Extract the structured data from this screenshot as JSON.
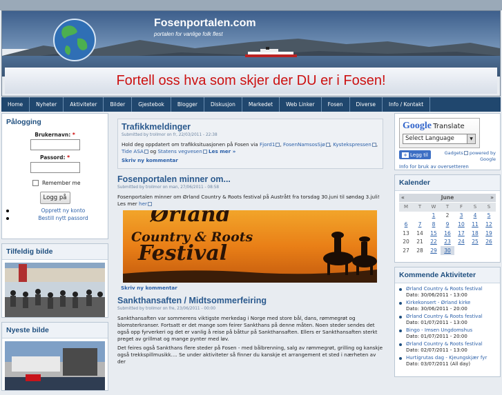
{
  "site": {
    "title": "Fosenportalen.com",
    "slogan": "portalen for vanlige folk flest",
    "banner": "Fortell oss hva som skjer der DU er i Fosen!"
  },
  "nav": [
    "Home",
    "Nyheter",
    "Aktiviteter",
    "Bilder",
    "Gjestebok",
    "Blogger",
    "Diskusjon",
    "Markedet",
    "Web Linker",
    "Fosen",
    "Diverse",
    "Info / Kontakt"
  ],
  "login": {
    "title": "Pålogging",
    "username_label": "Brukernavn:",
    "password_label": "Passord:",
    "required_mark": "*",
    "remember": "Remember me",
    "button": "Logg på",
    "links": [
      "Opprett ny konto",
      "Bestill nytt passord"
    ]
  },
  "random_image": {
    "title": "Tilfeldig bilde"
  },
  "newest_image": {
    "title": "Nyeste bilde"
  },
  "articles": [
    {
      "title": "Trafikkmeldinger",
      "submitted": "Submitted by trollmor on fr, 22/03/2011 - 22:38",
      "body_start": "Hold deg oppdatert om trafikksituasjonen på Fosen via ",
      "links": [
        "Fjord1",
        "FosenNamsosSjø",
        "Kystekspressen",
        "Tide ASA",
        "Statens vegvesen"
      ],
      "read_more": "Les mer »",
      "comment": "Skriv ny kommentar"
    },
    {
      "title": "Fosenportalen minner om...",
      "submitted": "Submitted by trollmor on man, 27/06/2011 - 08:58",
      "body": "Fosenportalen minner om Ørland Country & Roots festival på Austrått fra torsdag 30.juni til søndag 3.juli! Les mer",
      "here": "her",
      "image_text_1": "Ørland",
      "image_text_2": "Country & Roots",
      "image_text_3": "Festival",
      "comment": "Skriv ny kommentar"
    },
    {
      "title": "Sankthansaften / Midtsommerfeiring",
      "submitted": "Submitted by trollmor on fre, 23/06/2011 - 00:00",
      "body1": "Sankthansaften var sommerens viktigste merkedag i Norge med store bål, dans, rømmegrøt og blomsterkranser. Fortsatt er det mange som feirer Sankthans på denne måten. Noen steder sendes det også opp fyrverkeri og det er vanlig å reise på båttur på Sankthansaften. Ellers er Sankthansaften sterkt preget av grillmat og mange pynter med løv.",
      "body2": "Det feires også Sankthans flere steder på Fosen - med bålbrenning, salg av rømmegrøt, grilling og kanskje også trekkspillmusikk.... Se under aktiviteter så finner du kanskje et arrangement et sted i nærheten av der"
    }
  ],
  "translate": {
    "google": "Google",
    "translate": "Translate",
    "select": "Select Language",
    "gadgets": "Gadgets",
    "powered": "powered by",
    "google2": "Google",
    "info": "Info for bruk av oversetteren",
    "add_button": "Legg til"
  },
  "calendar": {
    "title": "Kalender",
    "prev": "«",
    "month": "June",
    "next": "»",
    "days": [
      "M",
      "T",
      "W",
      "T",
      "F",
      "S",
      "S"
    ],
    "weeks": [
      [
        "",
        "",
        "1",
        "2",
        "3",
        "4",
        "5"
      ],
      [
        "6",
        "7",
        "8",
        "9",
        "10",
        "11",
        "12"
      ],
      [
        "13",
        "14",
        "15",
        "16",
        "17",
        "18",
        "19"
      ],
      [
        "20",
        "21",
        "22",
        "23",
        "24",
        "25",
        "26"
      ],
      [
        "27",
        "28",
        "29",
        "30",
        "",
        "",
        ""
      ]
    ],
    "linked": [
      "1",
      "3",
      "4",
      "5",
      "6",
      "7",
      "8",
      "9",
      "10",
      "11",
      "12",
      "15",
      "16",
      "17",
      "18",
      "19",
      "22",
      "23",
      "24",
      "25",
      "26",
      "29",
      "30"
    ],
    "today": "30"
  },
  "upcoming": {
    "title": "Kommende Aktiviteter",
    "items": [
      {
        "name": "Ørland Country & Roots festival",
        "date": "Dato: 30/06/2011 - 13:00"
      },
      {
        "name": "Kirkekonsert - Ørland kirke",
        "date": "Dato: 30/06/2011 - 20:00"
      },
      {
        "name": "Ørland Country & Roots festival",
        "date": "Dato: 01/07/2011 - 13:00"
      },
      {
        "name": "Bingo - Imsen Ungdomshus",
        "date": "Dato: 01/07/2011 - 20:00"
      },
      {
        "name": "Ørland Country & Roots festival",
        "date": "Dato: 02/07/2011 - 13:00"
      },
      {
        "name": "Hurtigrutas dag - Kjeungskjær fyr",
        "date": "Dato: 03/07/2011 (All day)"
      }
    ]
  }
}
